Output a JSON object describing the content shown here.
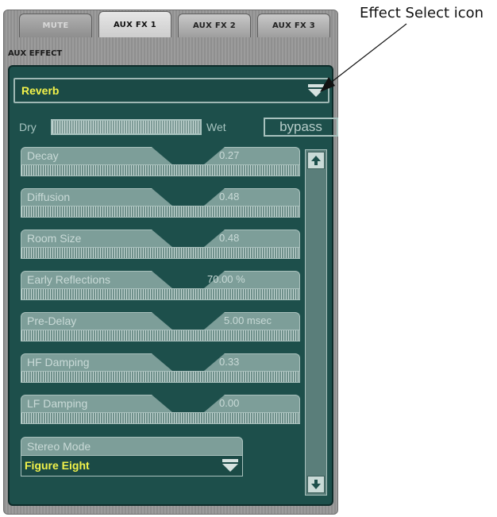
{
  "tabs": [
    {
      "label": "MUTE"
    },
    {
      "label": "AUX FX 1"
    },
    {
      "label": "AUX FX 2"
    },
    {
      "label": "AUX FX 3"
    }
  ],
  "section_label": "AUX EFFECT",
  "effect": {
    "name": "Reverb",
    "icon": "chevron-down-icon"
  },
  "dry_wet": {
    "dry_label": "Dry",
    "wet_label": "Wet",
    "bypass_label": "bypass",
    "mix": 1.0
  },
  "params": [
    {
      "label": "Decay",
      "value": "0.27"
    },
    {
      "label": "Diffusion",
      "value": "0.48"
    },
    {
      "label": "Room Size",
      "value": "0.48"
    },
    {
      "label": "Early Reflections",
      "value": "70.00 %"
    },
    {
      "label": "Pre-Delay",
      "value": "5.00 msec"
    },
    {
      "label": "HF Damping",
      "value": "0.33"
    },
    {
      "label": "LF Damping",
      "value": "0.00"
    }
  ],
  "stereo_mode": {
    "label": "Stereo Mode",
    "value": "Figure Eight"
  },
  "callout": {
    "text": "Effect Select icon"
  },
  "colors": {
    "panel": "#1d4f4b",
    "highlight_text": "#f2f24a",
    "param_bg": "#7d9e99"
  }
}
